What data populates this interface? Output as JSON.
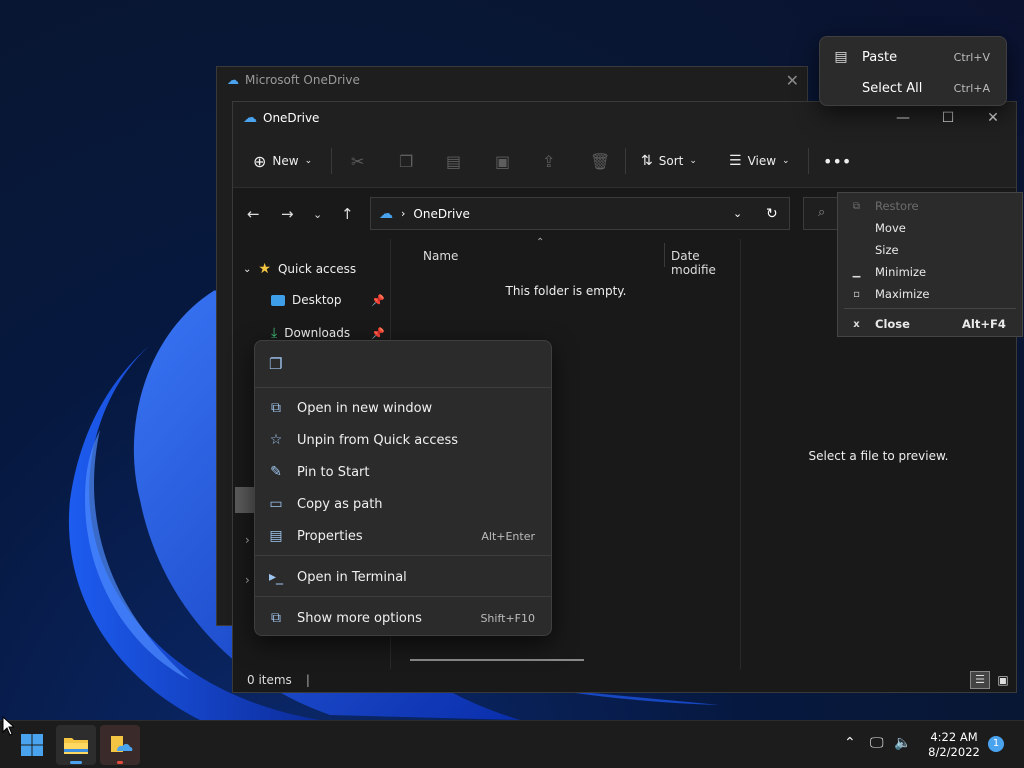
{
  "background_window": {
    "title": "Microsoft OneDrive"
  },
  "window": {
    "title": "OneDrive",
    "toolbar": {
      "new_label": "New",
      "sort_label": "Sort",
      "view_label": "View"
    },
    "address": {
      "location": "OneDrive"
    },
    "nav": {
      "quick_access": "Quick access",
      "items": [
        {
          "label": "Desktop"
        },
        {
          "label": "Downloads"
        }
      ]
    },
    "columns": {
      "name": "Name",
      "date": "Date modifie"
    },
    "empty_message": "This folder is empty.",
    "preview_message": "Select a file to preview.",
    "status": {
      "items": "0 items"
    }
  },
  "context_menu": {
    "items": [
      {
        "label": "Open in new window",
        "shortcut": ""
      },
      {
        "label": "Unpin from Quick access",
        "shortcut": ""
      },
      {
        "label": "Pin to Start",
        "shortcut": ""
      },
      {
        "label": "Copy as path",
        "shortcut": ""
      },
      {
        "label": "Properties",
        "shortcut": "Alt+Enter"
      },
      {
        "label": "Open in Terminal",
        "shortcut": ""
      },
      {
        "label": "Show more options",
        "shortcut": "Shift+F10"
      }
    ]
  },
  "paste_menu": {
    "items": [
      {
        "label": "Paste",
        "shortcut": "Ctrl+V"
      },
      {
        "label": "Select All",
        "shortcut": "Ctrl+A"
      }
    ]
  },
  "system_menu": {
    "items": [
      {
        "label": "Restore",
        "shortcut": ""
      },
      {
        "label": "Move",
        "shortcut": ""
      },
      {
        "label": "Size",
        "shortcut": ""
      },
      {
        "label": "Minimize",
        "shortcut": ""
      },
      {
        "label": "Maximize",
        "shortcut": ""
      },
      {
        "label": "Close",
        "shortcut": "Alt+F4"
      }
    ]
  },
  "taskbar": {
    "time": "4:22 AM",
    "date": "8/2/2022",
    "notifications": "1"
  },
  "colors": {
    "accent": "#4aa3ef",
    "wallpaper": "#1a55e0",
    "folder": "#f4c542"
  }
}
